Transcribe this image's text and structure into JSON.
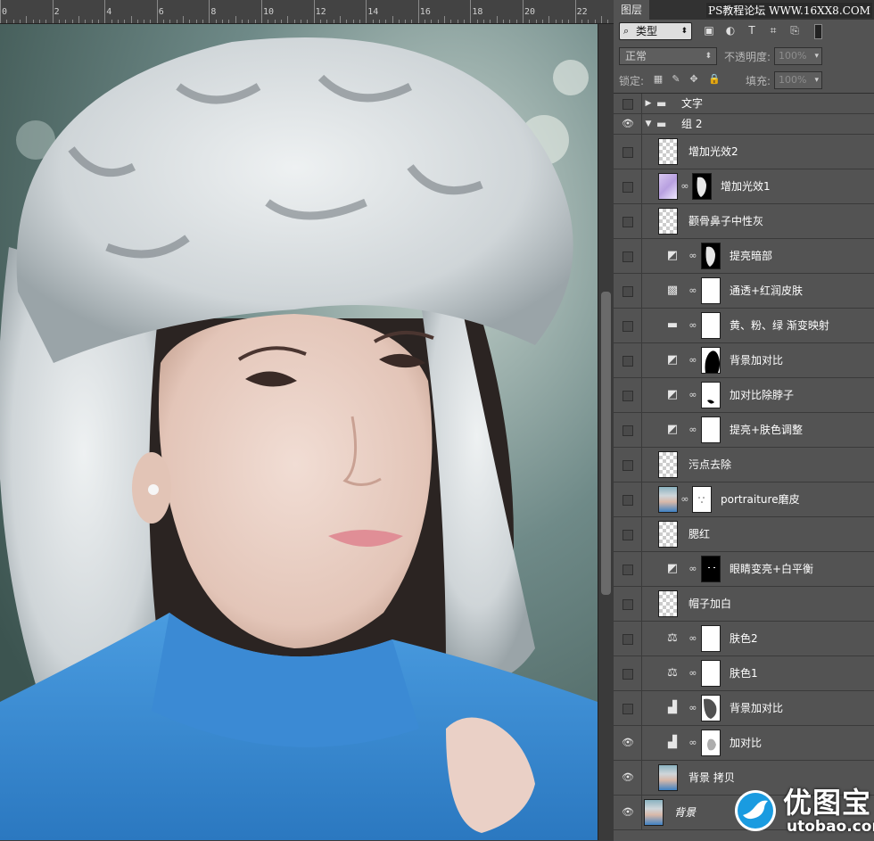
{
  "ruler": {
    "ticks": [
      "0",
      "2",
      "4",
      "6",
      "8",
      "10",
      "12",
      "14",
      "16",
      "18",
      "20",
      "22"
    ]
  },
  "panel": {
    "tab": "图层",
    "watermark": "PS教程论坛 WWW.16XX8.COM",
    "filter": {
      "label": "类型"
    },
    "blend_mode": "正常",
    "opacity_label": "不透明度:",
    "opacity_value": "100%",
    "lock_label": "锁定:",
    "fill_label": "填充:",
    "fill_value": "100%"
  },
  "layers": [
    {
      "name": "文字",
      "kind": "group-collapsed",
      "visible": false
    },
    {
      "name": "组 2",
      "kind": "group-open",
      "visible": true
    },
    {
      "name": "增加光效2",
      "kind": "pixel",
      "thumb": "checker",
      "visible": false
    },
    {
      "name": "增加光效1",
      "kind": "pixel-mask",
      "thumb": "purple",
      "mask": "dark-shape",
      "visible": false
    },
    {
      "name": "颧骨鼻子中性灰",
      "kind": "pixel",
      "thumb": "checker",
      "visible": false
    },
    {
      "name": "提亮暗部",
      "kind": "adjustment",
      "adj_icon": "curves-icon",
      "mask": "dark-shape",
      "visible": false
    },
    {
      "name": "通透+红润皮肤",
      "kind": "adjustment",
      "adj_icon": "channel-mixer-icon",
      "mask": "white",
      "visible": false
    },
    {
      "name": "黄、粉、绿 渐变映射",
      "kind": "adjustment",
      "adj_icon": "gradient-map-icon",
      "mask": "white",
      "visible": false
    },
    {
      "name": "背景加对比",
      "kind": "adjustment",
      "adj_icon": "curves-icon",
      "mask": "silhouette",
      "visible": false
    },
    {
      "name": "加对比除脖子",
      "kind": "adjustment",
      "adj_icon": "curves-icon",
      "mask": "small-mark",
      "visible": false
    },
    {
      "name": "提亮+肤色调整",
      "kind": "adjustment",
      "adj_icon": "curves-icon",
      "mask": "white",
      "visible": false
    },
    {
      "name": "污点去除",
      "kind": "pixel",
      "thumb": "checker",
      "visible": false
    },
    {
      "name": "portraiture磨皮",
      "kind": "pixel-mask",
      "thumb": "photo",
      "mask": "face-dots",
      "visible": false
    },
    {
      "name": "腮红",
      "kind": "pixel",
      "thumb": "checker",
      "visible": false
    },
    {
      "name": "眼睛变亮+白平衡",
      "kind": "adjustment",
      "adj_icon": "curves-icon",
      "mask": "black",
      "visible": false
    },
    {
      "name": "帽子加白",
      "kind": "pixel",
      "thumb": "checker",
      "visible": false
    },
    {
      "name": "肤色2",
      "kind": "adjustment",
      "adj_icon": "color-balance-icon",
      "mask": "white",
      "visible": false
    },
    {
      "name": "肤色1",
      "kind": "adjustment",
      "adj_icon": "color-balance-icon",
      "mask": "white",
      "visible": false
    },
    {
      "name": "背景加对比",
      "kind": "adjustment",
      "adj_icon": "levels-icon",
      "mask": "gray-shape",
      "visible": false
    },
    {
      "name": "加对比",
      "kind": "adjustment",
      "adj_icon": "levels-icon",
      "mask": "light-shape",
      "visible": true
    },
    {
      "name": "背景 拷贝",
      "kind": "pixel",
      "thumb": "photo",
      "visible": true
    },
    {
      "name": "背景",
      "kind": "background",
      "thumb": "photo",
      "visible": true
    }
  ],
  "logo": {
    "title": "优图宝",
    "url": "utobao.com",
    "color": "#1a9be0"
  }
}
